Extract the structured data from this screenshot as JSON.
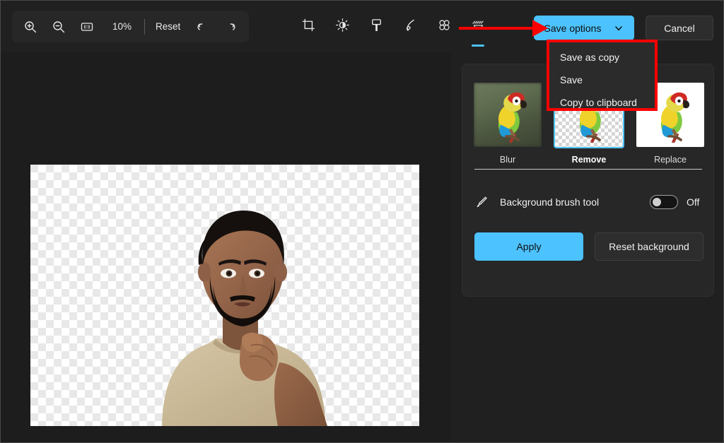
{
  "toolbar": {
    "zoom_in_icon": "zoom-in-icon",
    "zoom_out_icon": "zoom-out-icon",
    "actual_size_icon": "one-to-one-icon",
    "zoom_level": "10%",
    "reset_label": "Reset",
    "undo_icon": "undo-icon",
    "redo_icon": "redo-icon"
  },
  "tools": [
    {
      "name": "crop-tool",
      "icon": "crop-icon",
      "active": false
    },
    {
      "name": "adjustment-tool",
      "icon": "brightness-icon",
      "active": false
    },
    {
      "name": "filter-tool",
      "icon": "paint-roller-icon",
      "active": false
    },
    {
      "name": "markup-tool",
      "icon": "pen-icon",
      "active": false
    },
    {
      "name": "erase-objects-tool",
      "icon": "blur-circles-icon",
      "active": false
    },
    {
      "name": "background-tool",
      "icon": "background-eraser-icon",
      "active": true
    }
  ],
  "actions": {
    "save_options_label": "Save options",
    "save_options_chevron": "chevron-down-icon",
    "cancel_label": "Cancel"
  },
  "save_menu": {
    "items": [
      {
        "label": "Save as copy"
      },
      {
        "label": "Save"
      },
      {
        "label": "Copy to clipboard"
      }
    ],
    "highlight_color": "#ff0000"
  },
  "annotation": {
    "arrow_color": "#ff0000",
    "points_to": "save-options-button"
  },
  "canvas": {
    "image_alt": "Person with background removed shown on transparency checkerboard"
  },
  "background_panel": {
    "options": [
      {
        "label": "Blur",
        "selected": false
      },
      {
        "label": "Remove",
        "selected": true
      },
      {
        "label": "Replace",
        "selected": false
      }
    ],
    "brush": {
      "icon": "brush-icon",
      "label": "Background brush tool",
      "toggle_state": "Off",
      "toggle_on": false
    },
    "apply_label": "Apply",
    "reset_background_label": "Reset background"
  },
  "colors": {
    "accent": "#4cc2ff",
    "window_bg": "#202020",
    "canvas_bg": "#1d1d1d",
    "card_bg": "#272727",
    "menu_bg": "#2b2b2b",
    "highlight": "#ff0000"
  }
}
